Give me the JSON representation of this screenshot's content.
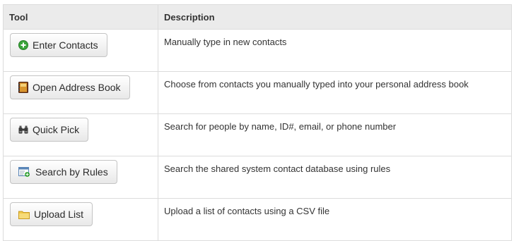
{
  "table": {
    "headers": {
      "tool": "Tool",
      "description": "Description"
    },
    "rows": [
      {
        "label": "Enter Contacts",
        "icon": "add-icon",
        "description": "Manually type in new contacts"
      },
      {
        "label": "Open Address Book",
        "icon": "address-book-icon",
        "description": "Choose from contacts you manually typed into your personal address book"
      },
      {
        "label": "Quick Pick",
        "icon": "binoculars-icon",
        "description": "Search for people by name, ID#, email, or phone number"
      },
      {
        "label": "Search by Rules",
        "icon": "rules-search-icon",
        "description": "Search the shared system contact database using rules"
      },
      {
        "label": "Upload List",
        "icon": "folder-icon",
        "description": "Upload a list of contacts using a CSV file"
      }
    ]
  },
  "colors": {
    "header_background": "#ebebeb",
    "border": "#dcdcdc",
    "add_icon_green": "#3aa43a",
    "folder_yellow": "#f0c84a"
  }
}
